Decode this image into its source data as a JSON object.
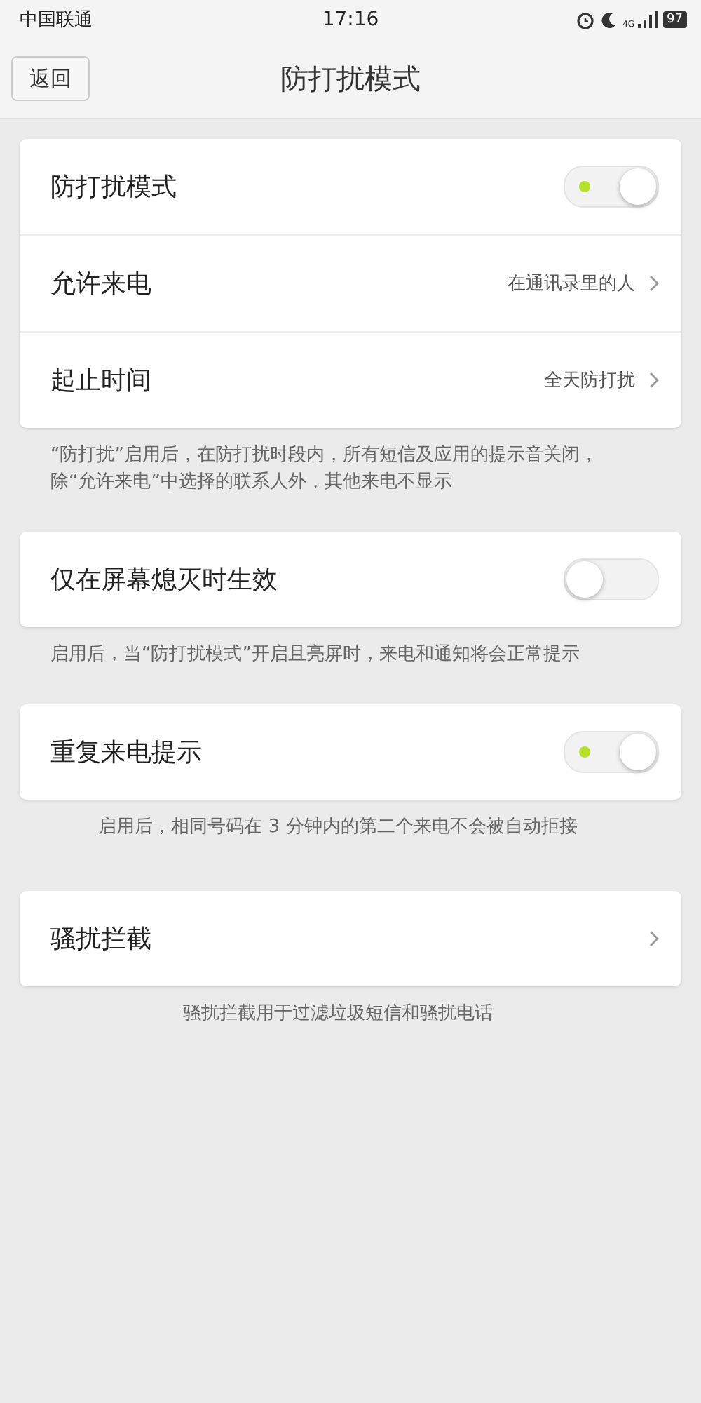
{
  "status_bar": {
    "carrier": "中国联通",
    "time": "17:16",
    "network": "4G",
    "battery": "97"
  },
  "header": {
    "back": "返回",
    "title": "防打扰模式"
  },
  "sections": [
    {
      "rows": [
        {
          "kind": "toggle",
          "label": "防打扰模式",
          "on": true
        },
        {
          "kind": "link",
          "label": "允许来电",
          "value": "在通讯录里的人"
        },
        {
          "kind": "link",
          "label": "起止时间",
          "value": "全天防打扰"
        }
      ],
      "note": "“防打扰”启用后，在防打扰时段内，所有短信及应用的提示音关闭，除“允许来电”中选择的联系人外，其他来电不显示",
      "note_centered": false
    },
    {
      "rows": [
        {
          "kind": "toggle",
          "label": "仅在屏幕熄灭时生效",
          "on": false
        }
      ],
      "note": "启用后，当“防打扰模式”开启且亮屏时，来电和通知将会正常提示",
      "note_centered": false
    },
    {
      "rows": [
        {
          "kind": "toggle",
          "label": "重复来电提示",
          "on": true
        }
      ],
      "note": "启用后，相同号码在 3 分钟内的第二个来电不会被自动拒接",
      "note_centered": true
    },
    {
      "rows": [
        {
          "kind": "link",
          "label": "骚扰拦截"
        }
      ],
      "note": "骚扰拦截用于过滤垃圾短信和骚扰电话",
      "note_centered": true
    }
  ]
}
